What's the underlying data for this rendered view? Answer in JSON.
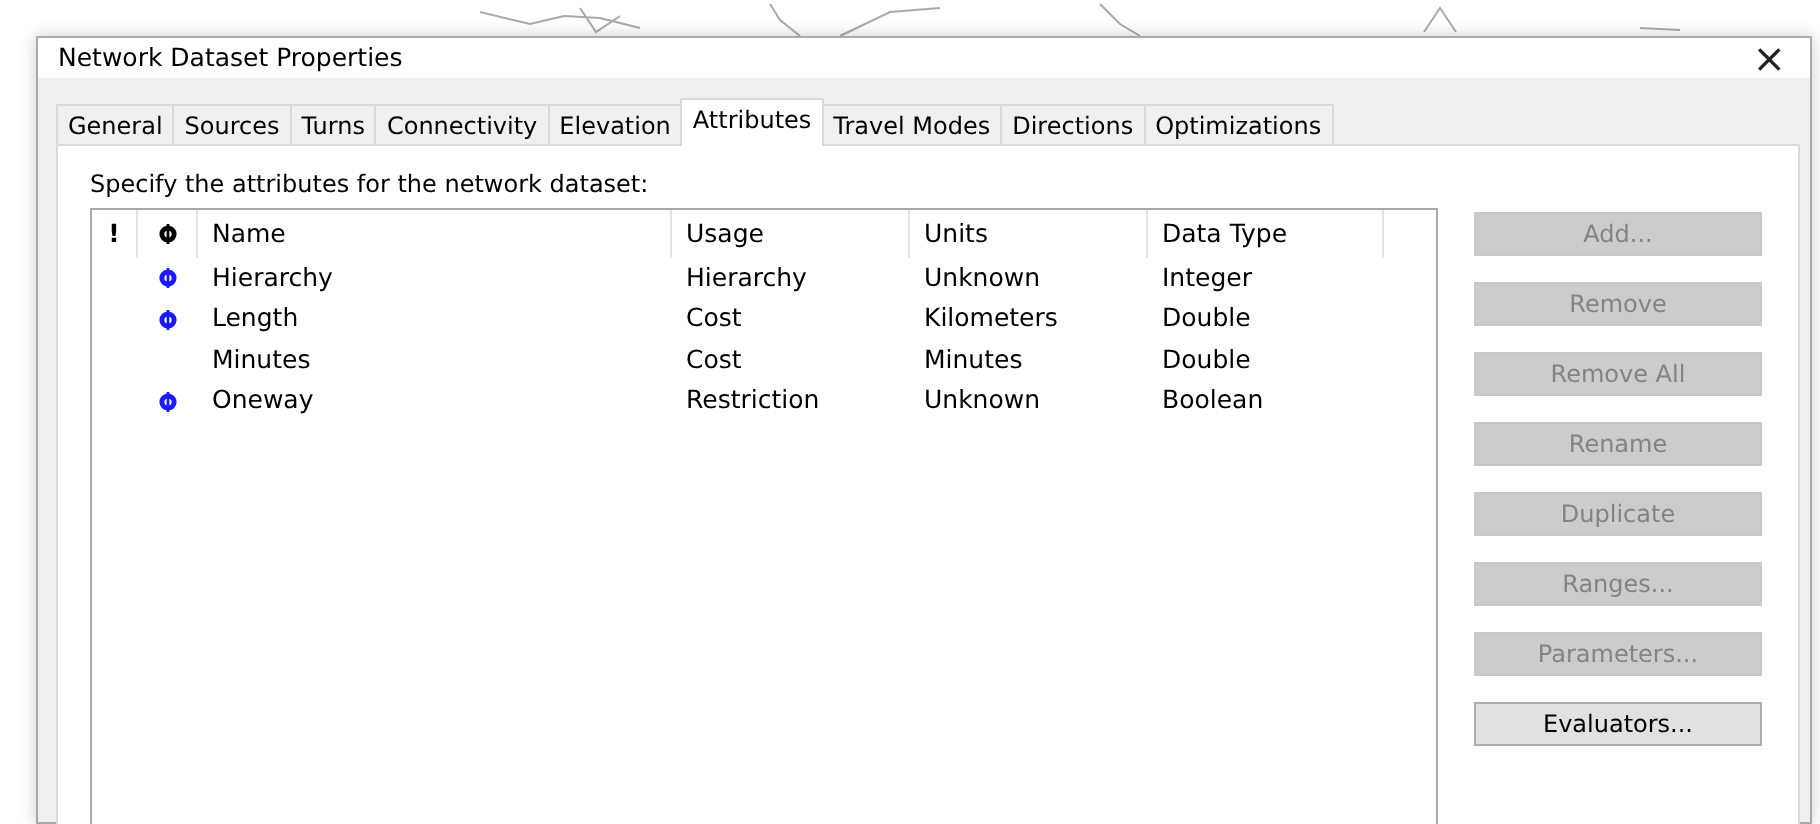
{
  "window": {
    "title": "Network Dataset Properties",
    "close": "×"
  },
  "tabs": [
    {
      "label": "General",
      "selected": false
    },
    {
      "label": "Sources",
      "selected": false
    },
    {
      "label": "Turns",
      "selected": false
    },
    {
      "label": "Connectivity",
      "selected": false
    },
    {
      "label": "Elevation",
      "selected": false
    },
    {
      "label": "Attributes",
      "selected": true
    },
    {
      "label": "Travel Modes",
      "selected": false
    },
    {
      "label": "Directions",
      "selected": false
    },
    {
      "label": "Optimizations",
      "selected": false
    }
  ],
  "instruction": "Specify the attributes for the network dataset:",
  "table": {
    "flag_column": "!",
    "columns": [
      "Name",
      "Usage",
      "Units",
      "Data Type"
    ],
    "rows": [
      {
        "default": true,
        "cells": [
          "Hierarchy",
          "Hierarchy",
          "Unknown",
          "Integer"
        ]
      },
      {
        "default": true,
        "cells": [
          "Length",
          "Cost",
          "Kilometers",
          "Double"
        ]
      },
      {
        "default": false,
        "cells": [
          "Minutes",
          "Cost",
          "Minutes",
          "Double"
        ]
      },
      {
        "default": true,
        "cells": [
          "Oneway",
          "Restriction",
          "Unknown",
          "Boolean"
        ]
      }
    ]
  },
  "buttons": [
    {
      "label": "Add...",
      "disabled": true
    },
    {
      "label": "Remove",
      "disabled": true
    },
    {
      "label": "Remove All",
      "disabled": true
    },
    {
      "label": "Rename",
      "disabled": true
    },
    {
      "label": "Duplicate",
      "disabled": true
    },
    {
      "label": "Ranges...",
      "disabled": true
    },
    {
      "label": "Parameters...",
      "disabled": true
    },
    {
      "label": "Evaluators...",
      "disabled": false
    }
  ]
}
